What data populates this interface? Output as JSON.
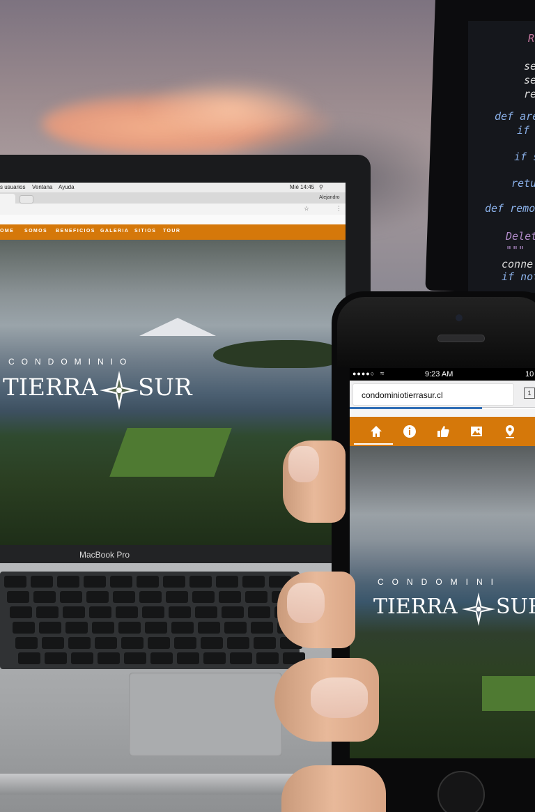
{
  "monitor_code": {
    "lines": [
      "R",
      "se",
      "se",
      "re",
      "def are",
      "if",
      "if s",
      "retu",
      "def remov",
      "Delet",
      "\"\"\"",
      "conne",
      "if not"
    ]
  },
  "laptop": {
    "menubar": {
      "items": [
        "s usuarios",
        "Ventana",
        "Ayuda"
      ],
      "clock": "Mié 14:45"
    },
    "browser": {
      "user": "Alejandro"
    },
    "site_nav": [
      "OME",
      "SOMOS",
      "BENEFICIOS",
      "GALERIA",
      "SITIOS",
      "TOUR"
    ],
    "brand": {
      "small": "CONDOMINIO",
      "left": "TIERRA",
      "right": "SUR"
    },
    "model_label": "MacBook Pro"
  },
  "phone": {
    "status": {
      "time": "9:23 AM",
      "battery": "10"
    },
    "url": "condominiotierrasur.cl",
    "tabs_count": "1",
    "nav_icons": [
      "home-icon",
      "info-icon",
      "thumbs-up-icon",
      "image-icon",
      "location-pin-icon"
    ],
    "brand": {
      "small": "CONDOMINI",
      "left": "TIERRA",
      "right": "SUR"
    }
  }
}
